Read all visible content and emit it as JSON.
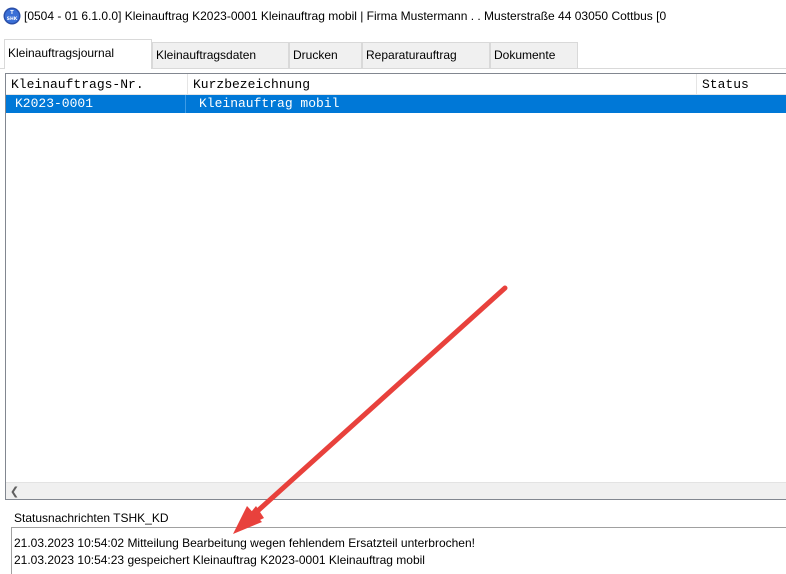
{
  "window": {
    "title": "[0504 - 01  6.1.0.0] Kleinauftrag K2023-0001 Kleinauftrag mobil |  Firma Mustermann . . Musterstraße 44 03050 Cottbus [0",
    "icon": "tshk-app-icon"
  },
  "tabs": [
    {
      "label": "Kleinauftragsjournal",
      "active": true
    },
    {
      "label": "Kleinauftragsdaten",
      "active": false
    },
    {
      "label": "Drucken",
      "active": false
    },
    {
      "label": "Reparaturauftrag",
      "active": false
    },
    {
      "label": "Dokumente",
      "active": false
    }
  ],
  "journal": {
    "columns": [
      "Kleinauftrags-Nr.",
      "Kurzbezeichnung",
      "Status"
    ],
    "rows": [
      {
        "nr": "K2023-0001",
        "bezeichnung": "Kleinauftrag mobil",
        "status": "",
        "selected": true
      }
    ],
    "scroll_left_icon": "scroll-left-arrow-icon"
  },
  "status": {
    "label": "Statusnachrichten TSHK_KD",
    "messages": [
      "21.03.2023 10:54:02 Mitteilung  Bearbeitung wegen fehlendem Ersatzteil unterbrochen!",
      "21.03.2023 10:54:23 gespeichert  Kleinauftrag K2023-0001 Kleinauftrag mobil"
    ]
  },
  "colors": {
    "selection": "#0078d7",
    "annotation_arrow": "#e8413c"
  }
}
